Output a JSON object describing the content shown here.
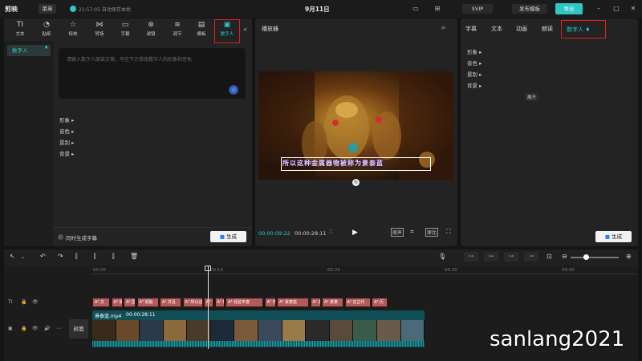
{
  "titlebar": {
    "logo": "剪映",
    "menu": "菜单",
    "autosave": "21:57:05 自动保存本地",
    "doc_title": "9月11日",
    "svip": "SVIP",
    "publish": "发布模板",
    "export": "导出"
  },
  "tools": [
    {
      "label": "文本",
      "icon": "text-icon",
      "glyph": "TI"
    },
    {
      "label": "贴纸",
      "icon": "sticker-icon",
      "glyph": "◔"
    },
    {
      "label": "特效",
      "icon": "effects-icon",
      "glyph": "☆"
    },
    {
      "label": "转场",
      "icon": "transition-icon",
      "glyph": "⋈"
    },
    {
      "label": "字幕",
      "icon": "subtitle-icon",
      "glyph": "▭"
    },
    {
      "label": "滤镜",
      "icon": "filter-icon",
      "glyph": "⊛"
    },
    {
      "label": "调节",
      "icon": "adjust-icon",
      "glyph": "≡"
    },
    {
      "label": "模板",
      "icon": "template-icon",
      "glyph": "▤"
    },
    {
      "label": "数字人",
      "icon": "digital-human-icon",
      "glyph": "▣"
    }
  ],
  "left": {
    "sidebar_item": "数字人",
    "textarea_placeholder": "请输入数字人朗读文案，可在下方修改数字人的形象和音色",
    "props": [
      "形象",
      "音色",
      "景别",
      "背景"
    ],
    "subtitle_check": "同时生成字幕",
    "generate": "生成"
  },
  "player": {
    "title": "播放器",
    "caption": "所以这种金属器物被称为景泰蓝",
    "time_current": "00:00:09:22",
    "time_total": "00:00:28:11",
    "ratio_label": "原比",
    "original_label": "原声"
  },
  "right": {
    "tabs": [
      "字幕",
      "文本",
      "动画",
      "朗读"
    ],
    "active_tab": "数字人",
    "props": [
      "形象",
      "音色",
      "景别",
      "背景"
    ],
    "expand_tip": "展开",
    "generate": "生成"
  },
  "timeline": {
    "ruler": [
      "00:00",
      "00:10",
      "00:20",
      "00:30",
      "00:40"
    ],
    "text_clips": [
      "A³ 文",
      "A³ 我",
      "A³ 国",
      "A³ 铜胎",
      "A³ 并且",
      "A³ 所以这",
      "A³ 它",
      "A³ 但",
      "A³ 经验丰富",
      "A³ 作",
      "A³ 景泰蓝",
      "A³ 由",
      "A³ 景泰",
      "A³ 在古代",
      "A³ 历"
    ],
    "cover": "封面",
    "clip_name": "景泰蓝.mp4",
    "clip_duration": "00:00:28:11"
  },
  "watermark": "sanlang2021"
}
